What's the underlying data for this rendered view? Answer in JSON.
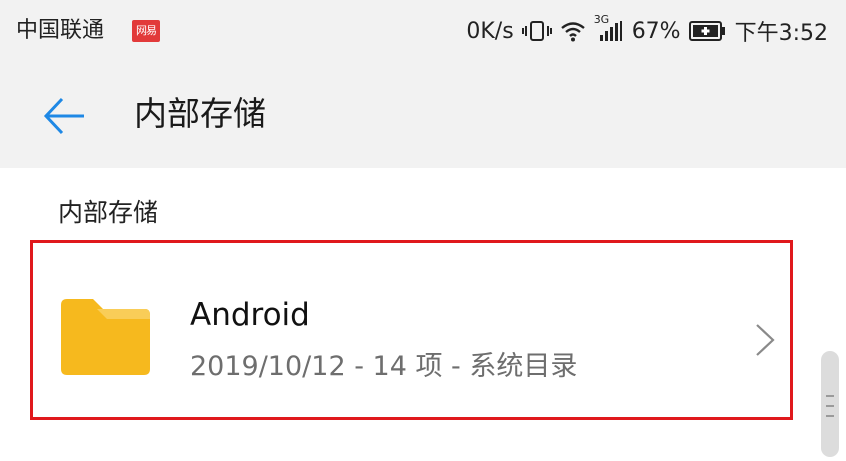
{
  "status_bar": {
    "carrier": "中国联通",
    "carrier_badge": "网易",
    "net_speed": "0K/s",
    "signal_label": "3G",
    "battery": "67%",
    "time": "下午3:52"
  },
  "header": {
    "title": "内部存储"
  },
  "breadcrumb": {
    "label": "内部存储"
  },
  "folders": [
    {
      "name": "Android",
      "meta": "2019/10/12 - 14 项 - 系统目录"
    }
  ],
  "colors": {
    "accent": "#1e88e5",
    "folder": "#f6b91e",
    "highlight_border": "#e0181c",
    "header_bg": "#f2f2f2"
  },
  "icons": {
    "back": "arrow-left-icon",
    "folder": "folder-icon",
    "chevron": "chevron-right-icon"
  }
}
